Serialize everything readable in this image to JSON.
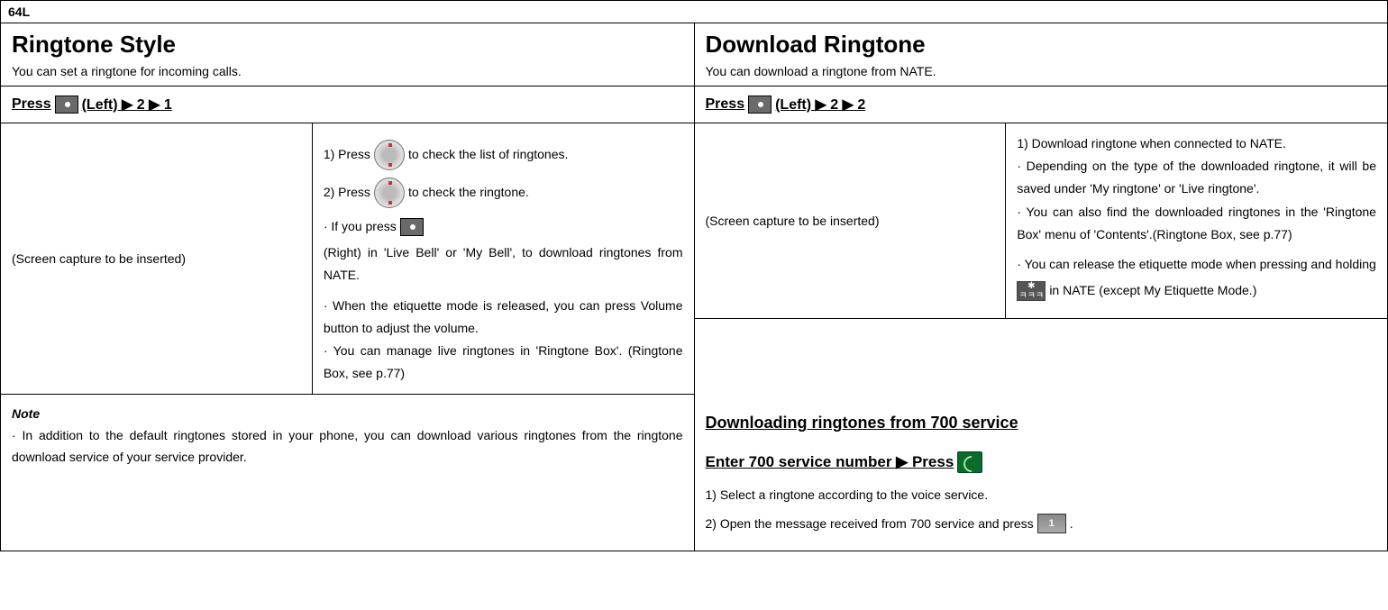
{
  "page_number": "64L",
  "left": {
    "title": "Ringtone Style",
    "subtitle": "You can set a ringtone for incoming calls.",
    "press_prefix": "Press",
    "press_suffix": "(Left) ▶ 2 ▶ 1",
    "screen_placeholder": "(Screen capture to be inserted)",
    "step1_a": "1) Press",
    "step1_b": "to check the list of ringtones.",
    "step2_a": "2) Press",
    "step2_b": "to check the ringtone.",
    "bullet1_a": "· If you press",
    "bullet1_b": "(Right) in 'Live Bell' or 'My Bell', to download ringtones from NATE.",
    "bullet2": "· When the etiquette mode is released, you can press Volume button to adjust the volume.",
    "bullet3": "· You can manage live ringtones in 'Ringtone Box'. (Ringtone Box, see p.77)",
    "note_title": "Note",
    "note_body": "· In addition to the default ringtones stored in your phone, you can download various ringtones from the ringtone download service of your service provider."
  },
  "right": {
    "title": "Download Ringtone",
    "subtitle": "You can download a ringtone from NATE.",
    "press_prefix": "Press",
    "press_suffix": "(Left) ▶ 2 ▶ 2",
    "screen_placeholder": "(Screen capture to be inserted)",
    "step1": "1) Download ringtone when connected to NATE.",
    "bullet1": "· Depending on the type of the downloaded ringtone, it will be saved under 'My ringtone' or 'Live ringtone'.",
    "bullet2": "· You can also find the downloaded ringtones in the 'Ringtone Box' menu of 'Contents'.(Ringtone Box, see p.77)",
    "bullet3_a": "· You can release the etiquette mode when pressing and holding",
    "bullet3_b": "in NATE (except My Etiquette Mode.)",
    "sub_heading": "Downloading ringtones from 700 service",
    "enter_line_a": "Enter 700 service number ▶ Press",
    "sub_step1": "1) Select a ringtone according to the voice service.",
    "sub_step2_a": "2) Open the message received from 700 service and press",
    "sub_step2_b": "."
  }
}
